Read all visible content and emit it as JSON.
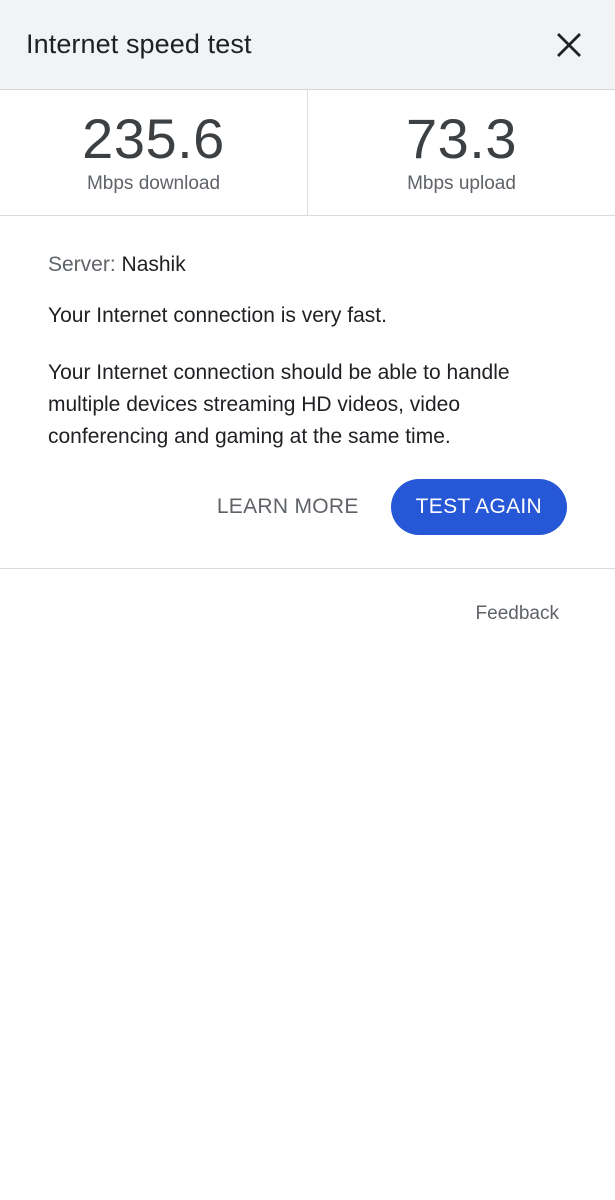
{
  "header": {
    "title": "Internet speed test",
    "close_icon": "close-icon"
  },
  "stats": {
    "download": {
      "value": "235.6",
      "label": "Mbps download"
    },
    "upload": {
      "value": "73.3",
      "label": "Mbps upload"
    }
  },
  "details": {
    "server_label": "Server:",
    "server_name": "Nashik",
    "summary": "Your Internet connection is very fast.",
    "description": "Your Internet connection should be able to handle multiple devices streaming HD videos, video conferencing and gaming at the same time."
  },
  "actions": {
    "learn_more": "LEARN MORE",
    "test_again": "TEST AGAIN"
  },
  "footer": {
    "feedback": "Feedback"
  },
  "colors": {
    "accent": "#2557d6",
    "header_bg": "#f1f3f4",
    "text": "#202124",
    "muted": "#5f6368"
  }
}
